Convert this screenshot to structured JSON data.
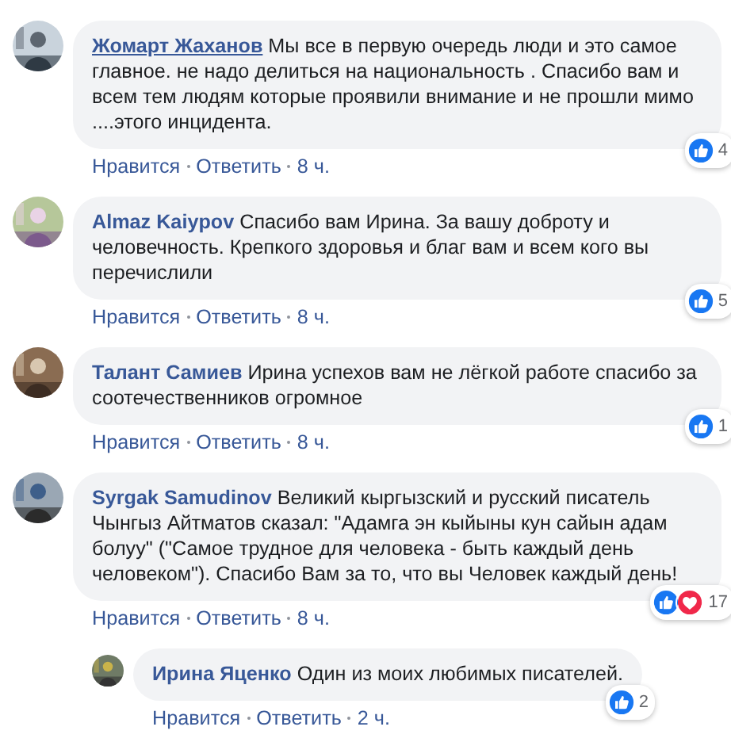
{
  "comments": [
    {
      "author": "Жомарт Жаханов",
      "author_hovered": true,
      "text": "Мы все в первую очередь люди и это самое главное. не надо делиться на национальность . Спасибо вам и всем тем людям которые проявили внимание и не прошли мимо ....этого инцидента.",
      "reactions": [
        {
          "kind": "like"
        }
      ],
      "reaction_count": "4",
      "like_label": "Нравится",
      "reply_label": "Ответить",
      "time": "8 ч."
    },
    {
      "author": "Almaz Kaiypov",
      "author_hovered": false,
      "text": "Спасибо вам Ирина. За вашу доброту и человечность. Крепкого здоровья и благ вам и всем кого вы перечислили",
      "reactions": [
        {
          "kind": "like"
        }
      ],
      "reaction_count": "5",
      "like_label": "Нравится",
      "reply_label": "Ответить",
      "time": "8 ч."
    },
    {
      "author": "Талант Самиев",
      "author_hovered": false,
      "text": "Ирина успехов вам не лёгкой работе спасибо за соотечественников огромное",
      "reactions": [
        {
          "kind": "like"
        }
      ],
      "reaction_count": "1",
      "like_label": "Нравится",
      "reply_label": "Ответить",
      "time": "8 ч."
    },
    {
      "author": "Syrgak Samudinov",
      "author_hovered": false,
      "text": "Великий кыргызский и русский писатель Чынгыз Айтматов сказал: \"Адамга эн кыйыны кун сайын адам болуу\" (\"Самое трудное для человека - быть каждый день человеком\"). Спасибо Вам за то, что вы Человек каждый день!",
      "reactions": [
        {
          "kind": "like"
        },
        {
          "kind": "love"
        }
      ],
      "reaction_count": "17",
      "like_label": "Нравится",
      "reply_label": "Ответить",
      "time": "8 ч.",
      "children": [
        {
          "author": "Ирина Яценко",
          "author_hovered": false,
          "text": "Один из моих любимых писателей.",
          "reactions": [
            {
              "kind": "like"
            }
          ],
          "reaction_count": "2",
          "like_label": "Нравится",
          "reply_label": "Ответить",
          "time": "2 ч."
        }
      ]
    }
  ]
}
